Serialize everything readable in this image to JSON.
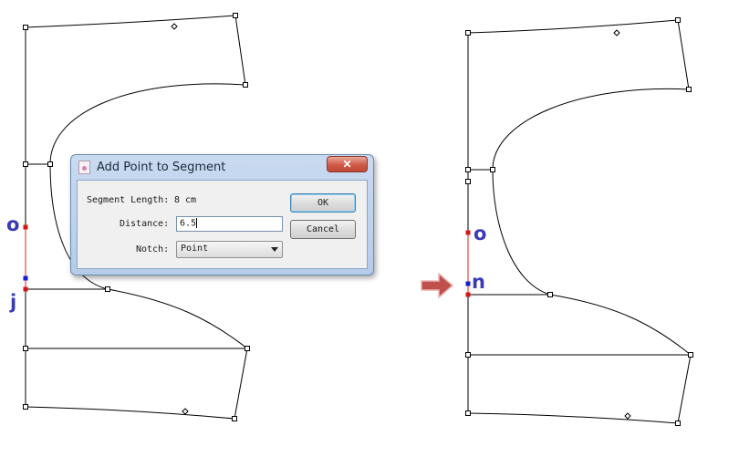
{
  "dialog": {
    "title": "Add Point to Segment",
    "close_label": "✕",
    "segment_length_label": "Segment Length:",
    "segment_length_value": "8 cm",
    "distance_label": "Distance:",
    "distance_value": "6.5",
    "notch_label": "Notch:",
    "notch_value": "Point",
    "ok_label": "OK",
    "cancel_label": "Cancel"
  },
  "left_pattern": {
    "labels": {
      "upper": "o",
      "lower": "j"
    }
  },
  "right_pattern": {
    "labels": {
      "upper": "o",
      "lower": "n"
    }
  },
  "colors": {
    "outline": "#000000",
    "selected_segment": "#e02020",
    "point_red": "#d01818",
    "point_blue": "#1020d0",
    "label": "#3b3bb5",
    "arrow": "#c0504d"
  },
  "icons": {
    "transition_arrow": "right-arrow-icon",
    "dialog_icon": "app-icon",
    "close": "close-icon"
  }
}
